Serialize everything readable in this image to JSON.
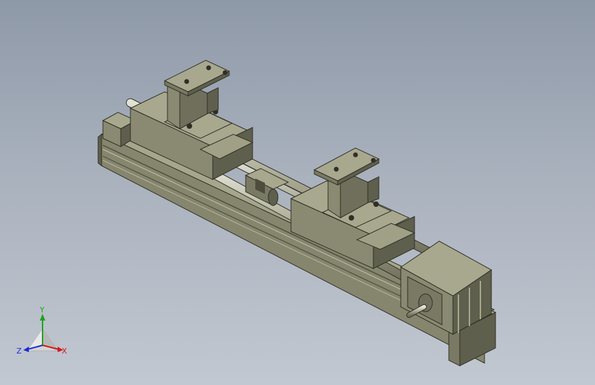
{
  "viewport": {
    "background_top": "#8e99a8",
    "background_bottom": "#c2c8d1"
  },
  "model": {
    "body_color": "#8a8a72",
    "shade_dark": "#5c5c4a",
    "shade_light": "#a8a88e",
    "rod_color": "#b9b9a6"
  },
  "triad": {
    "x_label": "X",
    "y_label": "Y",
    "z_label": "Z",
    "x_color": "#d11a1a",
    "y_color": "#1ca31c",
    "z_color": "#1a2bd1"
  }
}
